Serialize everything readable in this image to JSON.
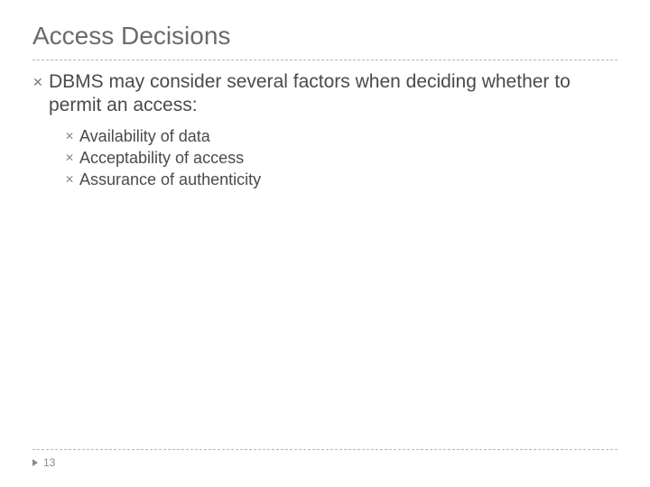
{
  "title": "Access Decisions",
  "lead": "DBMS may consider several factors when deciding whether to permit an access:",
  "subitems": [
    "Availability of data",
    "Acceptability of access",
    "Assurance of authenticity"
  ],
  "page_number": "13"
}
